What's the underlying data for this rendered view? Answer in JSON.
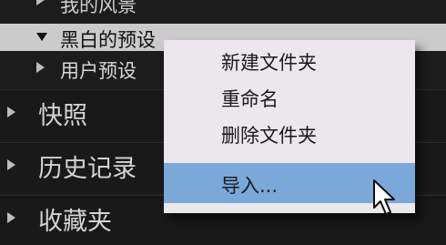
{
  "presets": {
    "partial_top_label": "我的风景",
    "bw_presets_label": "黑白的预设",
    "user_presets_label": "用户预设"
  },
  "sections": {
    "snapshots_label": "快照",
    "history_label": "历史记录",
    "collections_label": "收藏夹"
  },
  "context_menu": {
    "new_folder": "新建文件夹",
    "rename": "重命名",
    "delete_folder": "删除文件夹",
    "import": "导入..."
  },
  "colors": {
    "menu_background": "#ece7ec",
    "menu_highlight": "#7aa8d8",
    "panel_background": "#1c1c1c"
  },
  "icons": {
    "expanded": "triangle-down-icon",
    "collapsed": "triangle-right-icon",
    "pointer": "mouse-cursor-icon"
  }
}
